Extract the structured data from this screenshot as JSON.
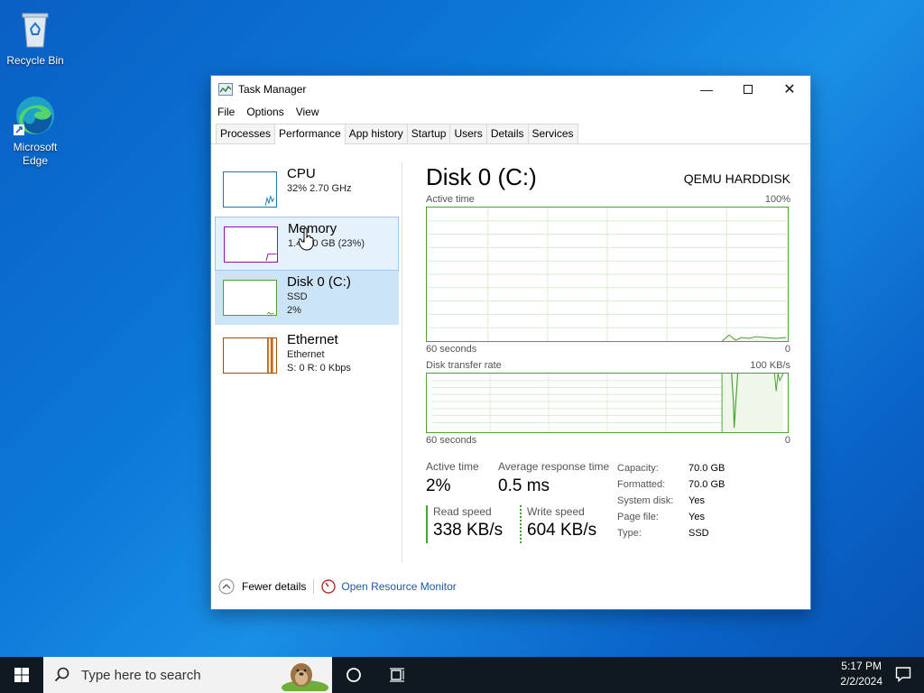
{
  "desktop": {
    "icons": [
      {
        "label": "Recycle Bin"
      },
      {
        "label": "Microsoft Edge"
      }
    ]
  },
  "window": {
    "title": "Task Manager",
    "menu": [
      "File",
      "Options",
      "View"
    ],
    "tabs": [
      "Processes",
      "Performance",
      "App history",
      "Startup",
      "Users",
      "Details",
      "Services"
    ],
    "active_tab": "Performance"
  },
  "resources": [
    {
      "name": "CPU",
      "sub1": "32% 2.70 GHz",
      "sub2": "",
      "color": "#117dbb"
    },
    {
      "name": "Memory",
      "sub1": "1.4/4.0 GB (23%)",
      "sub2": "",
      "color": "#8b12ae"
    },
    {
      "name": "Disk 0 (C:)",
      "sub1": "SSD",
      "sub2": "2%",
      "color": "#4da033"
    },
    {
      "name": "Ethernet",
      "sub1": "Ethernet",
      "sub2": "S: 0 R: 0 Kbps",
      "color": "#a74f01"
    }
  ],
  "detail": {
    "title": "Disk 0 (C:)",
    "model": "QEMU HARDDISK",
    "graph1": {
      "label": "Active time",
      "max": "100%",
      "time": "60 seconds",
      "min": "0"
    },
    "graph2": {
      "label": "Disk transfer rate",
      "max": "100 KB/s",
      "time": "60 seconds",
      "min": "0"
    },
    "stats": {
      "active_time_label": "Active time",
      "active_time": "2%",
      "avg_resp_label": "Average response time",
      "avg_resp": "0.5 ms",
      "read_label": "Read speed",
      "read": "338 KB/s",
      "write_label": "Write speed",
      "write": "604 KB/s"
    },
    "props": [
      {
        "k": "Capacity:",
        "v": "70.0 GB"
      },
      {
        "k": "Formatted:",
        "v": "70.0 GB"
      },
      {
        "k": "System disk:",
        "v": "Yes"
      },
      {
        "k": "Page file:",
        "v": "Yes"
      },
      {
        "k": "Type:",
        "v": "SSD"
      }
    ]
  },
  "footer": {
    "fewer": "Fewer details",
    "monitor": "Open Resource Monitor"
  },
  "taskbar": {
    "search_placeholder": "Type here to search",
    "time": "5:17 PM",
    "date": "2/2/2024"
  }
}
